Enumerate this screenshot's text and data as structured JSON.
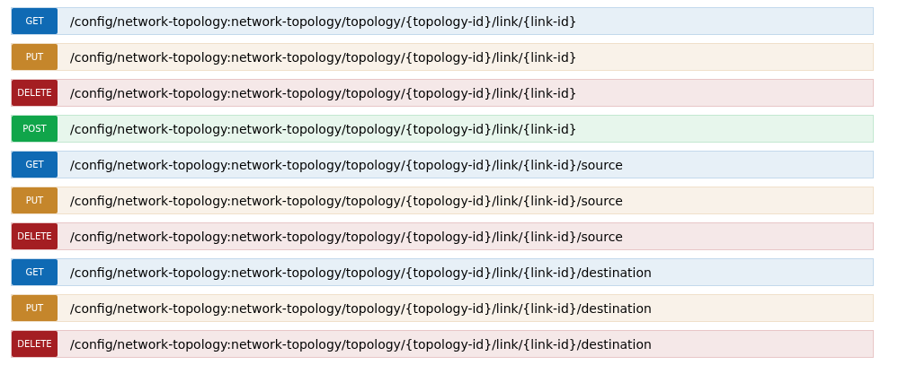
{
  "operations": [
    {
      "kind": "get",
      "method": "GET",
      "path": "/config/network-topology:network-topology/topology/{topology-id}/link/{link-id}"
    },
    {
      "kind": "put",
      "method": "PUT",
      "path": "/config/network-topology:network-topology/topology/{topology-id}/link/{link-id}"
    },
    {
      "kind": "delete",
      "method": "DELETE",
      "path": "/config/network-topology:network-topology/topology/{topology-id}/link/{link-id}"
    },
    {
      "kind": "post",
      "method": "POST",
      "path": "/config/network-topology:network-topology/topology/{topology-id}/link/{link-id}"
    },
    {
      "kind": "get",
      "method": "GET",
      "path": "/config/network-topology:network-topology/topology/{topology-id}/link/{link-id}/source"
    },
    {
      "kind": "put",
      "method": "PUT",
      "path": "/config/network-topology:network-topology/topology/{topology-id}/link/{link-id}/source"
    },
    {
      "kind": "delete",
      "method": "DELETE",
      "path": "/config/network-topology:network-topology/topology/{topology-id}/link/{link-id}/source"
    },
    {
      "kind": "get",
      "method": "GET",
      "path": "/config/network-topology:network-topology/topology/{topology-id}/link/{link-id}/destination"
    },
    {
      "kind": "put",
      "method": "PUT",
      "path": "/config/network-topology:network-topology/topology/{topology-id}/link/{link-id}/destination"
    },
    {
      "kind": "delete",
      "method": "DELETE",
      "path": "/config/network-topology:network-topology/topology/{topology-id}/link/{link-id}/destination"
    }
  ]
}
